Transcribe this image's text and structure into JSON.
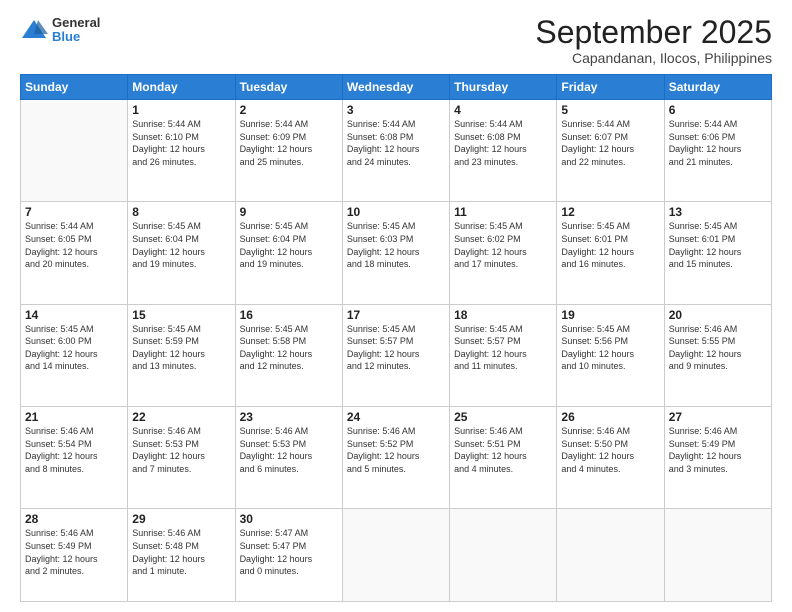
{
  "header": {
    "logo": {
      "general": "General",
      "blue": "Blue"
    },
    "title": "September 2025",
    "location": "Capandanan, Ilocos, Philippines"
  },
  "weekdays": [
    "Sunday",
    "Monday",
    "Tuesday",
    "Wednesday",
    "Thursday",
    "Friday",
    "Saturday"
  ],
  "weeks": [
    [
      {
        "day": "",
        "info": ""
      },
      {
        "day": "1",
        "info": "Sunrise: 5:44 AM\nSunset: 6:10 PM\nDaylight: 12 hours\nand 26 minutes."
      },
      {
        "day": "2",
        "info": "Sunrise: 5:44 AM\nSunset: 6:09 PM\nDaylight: 12 hours\nand 25 minutes."
      },
      {
        "day": "3",
        "info": "Sunrise: 5:44 AM\nSunset: 6:08 PM\nDaylight: 12 hours\nand 24 minutes."
      },
      {
        "day": "4",
        "info": "Sunrise: 5:44 AM\nSunset: 6:08 PM\nDaylight: 12 hours\nand 23 minutes."
      },
      {
        "day": "5",
        "info": "Sunrise: 5:44 AM\nSunset: 6:07 PM\nDaylight: 12 hours\nand 22 minutes."
      },
      {
        "day": "6",
        "info": "Sunrise: 5:44 AM\nSunset: 6:06 PM\nDaylight: 12 hours\nand 21 minutes."
      }
    ],
    [
      {
        "day": "7",
        "info": "Sunrise: 5:44 AM\nSunset: 6:05 PM\nDaylight: 12 hours\nand 20 minutes."
      },
      {
        "day": "8",
        "info": "Sunrise: 5:45 AM\nSunset: 6:04 PM\nDaylight: 12 hours\nand 19 minutes."
      },
      {
        "day": "9",
        "info": "Sunrise: 5:45 AM\nSunset: 6:04 PM\nDaylight: 12 hours\nand 19 minutes."
      },
      {
        "day": "10",
        "info": "Sunrise: 5:45 AM\nSunset: 6:03 PM\nDaylight: 12 hours\nand 18 minutes."
      },
      {
        "day": "11",
        "info": "Sunrise: 5:45 AM\nSunset: 6:02 PM\nDaylight: 12 hours\nand 17 minutes."
      },
      {
        "day": "12",
        "info": "Sunrise: 5:45 AM\nSunset: 6:01 PM\nDaylight: 12 hours\nand 16 minutes."
      },
      {
        "day": "13",
        "info": "Sunrise: 5:45 AM\nSunset: 6:01 PM\nDaylight: 12 hours\nand 15 minutes."
      }
    ],
    [
      {
        "day": "14",
        "info": "Sunrise: 5:45 AM\nSunset: 6:00 PM\nDaylight: 12 hours\nand 14 minutes."
      },
      {
        "day": "15",
        "info": "Sunrise: 5:45 AM\nSunset: 5:59 PM\nDaylight: 12 hours\nand 13 minutes."
      },
      {
        "day": "16",
        "info": "Sunrise: 5:45 AM\nSunset: 5:58 PM\nDaylight: 12 hours\nand 12 minutes."
      },
      {
        "day": "17",
        "info": "Sunrise: 5:45 AM\nSunset: 5:57 PM\nDaylight: 12 hours\nand 12 minutes."
      },
      {
        "day": "18",
        "info": "Sunrise: 5:45 AM\nSunset: 5:57 PM\nDaylight: 12 hours\nand 11 minutes."
      },
      {
        "day": "19",
        "info": "Sunrise: 5:45 AM\nSunset: 5:56 PM\nDaylight: 12 hours\nand 10 minutes."
      },
      {
        "day": "20",
        "info": "Sunrise: 5:46 AM\nSunset: 5:55 PM\nDaylight: 12 hours\nand 9 minutes."
      }
    ],
    [
      {
        "day": "21",
        "info": "Sunrise: 5:46 AM\nSunset: 5:54 PM\nDaylight: 12 hours\nand 8 minutes."
      },
      {
        "day": "22",
        "info": "Sunrise: 5:46 AM\nSunset: 5:53 PM\nDaylight: 12 hours\nand 7 minutes."
      },
      {
        "day": "23",
        "info": "Sunrise: 5:46 AM\nSunset: 5:53 PM\nDaylight: 12 hours\nand 6 minutes."
      },
      {
        "day": "24",
        "info": "Sunrise: 5:46 AM\nSunset: 5:52 PM\nDaylight: 12 hours\nand 5 minutes."
      },
      {
        "day": "25",
        "info": "Sunrise: 5:46 AM\nSunset: 5:51 PM\nDaylight: 12 hours\nand 4 minutes."
      },
      {
        "day": "26",
        "info": "Sunrise: 5:46 AM\nSunset: 5:50 PM\nDaylight: 12 hours\nand 4 minutes."
      },
      {
        "day": "27",
        "info": "Sunrise: 5:46 AM\nSunset: 5:49 PM\nDaylight: 12 hours\nand 3 minutes."
      }
    ],
    [
      {
        "day": "28",
        "info": "Sunrise: 5:46 AM\nSunset: 5:49 PM\nDaylight: 12 hours\nand 2 minutes."
      },
      {
        "day": "29",
        "info": "Sunrise: 5:46 AM\nSunset: 5:48 PM\nDaylight: 12 hours\nand 1 minute."
      },
      {
        "day": "30",
        "info": "Sunrise: 5:47 AM\nSunset: 5:47 PM\nDaylight: 12 hours\nand 0 minutes."
      },
      {
        "day": "",
        "info": ""
      },
      {
        "day": "",
        "info": ""
      },
      {
        "day": "",
        "info": ""
      },
      {
        "day": "",
        "info": ""
      }
    ]
  ]
}
